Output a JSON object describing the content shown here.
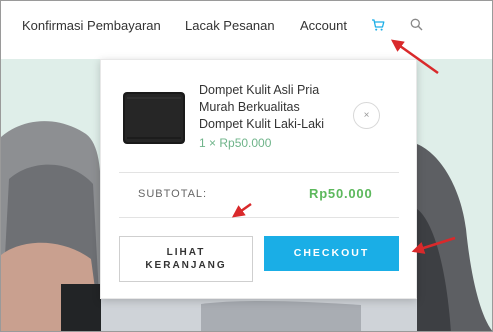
{
  "nav": {
    "items": [
      "Konfirmasi Pembayaran",
      "Lacak Pesanan",
      "Account"
    ]
  },
  "icons": {
    "cart": "cart-icon",
    "search": "search-icon"
  },
  "colors": {
    "accent_blue": "#1aaee6",
    "price_green": "#5cb85c",
    "hero_bg": "#dfeee9",
    "arrow_red": "#d9292b"
  },
  "cart_dropdown": {
    "product": {
      "title_lines": [
        "Dompet Kulit Asli Pria",
        "Murah Berkualitas",
        "Dompet Kulit Laki-Laki"
      ],
      "price": "1 × Rp50.000",
      "remove_label": "×"
    },
    "subtotal_label": "SUBTOTAL:",
    "subtotal_value": "Rp50.000",
    "view_cart_lines": [
      "LIHAT",
      "KERANJANG"
    ],
    "checkout_label": "CHECKOUT"
  }
}
